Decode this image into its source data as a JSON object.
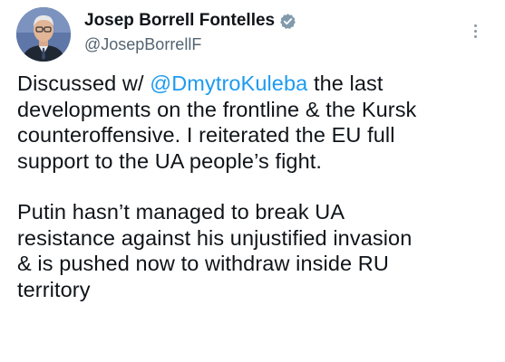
{
  "author": {
    "display_name": "Josep Borrell Fontelles",
    "handle": "@JosepBorrellF",
    "verified": true,
    "verified_icon": "verified-badge-icon",
    "avatar_icon": "avatar-photo",
    "more_icon": "more-vertical-icon"
  },
  "tweet": {
    "paragraph1": {
      "line1_before": "Discussed w/ ",
      "mention": "@DmytroKuleba",
      "line1_after": " the last",
      "line2": "developments on the frontline & the Kursk",
      "line3": "counteroffensive. I reiterated the EU full",
      "line4": "support to the UA people’s fight."
    },
    "paragraph2": {
      "line1": "Putin hasn’t managed to break UA",
      "line2": "resistance against his unjustified invasion",
      "line3": "& is pushed now to withdraw inside RU",
      "line4": "territory"
    }
  },
  "colors": {
    "accent": "#1d9bf0",
    "text": "#0f1419",
    "secondary": "#536471",
    "verified": "#829aab"
  }
}
